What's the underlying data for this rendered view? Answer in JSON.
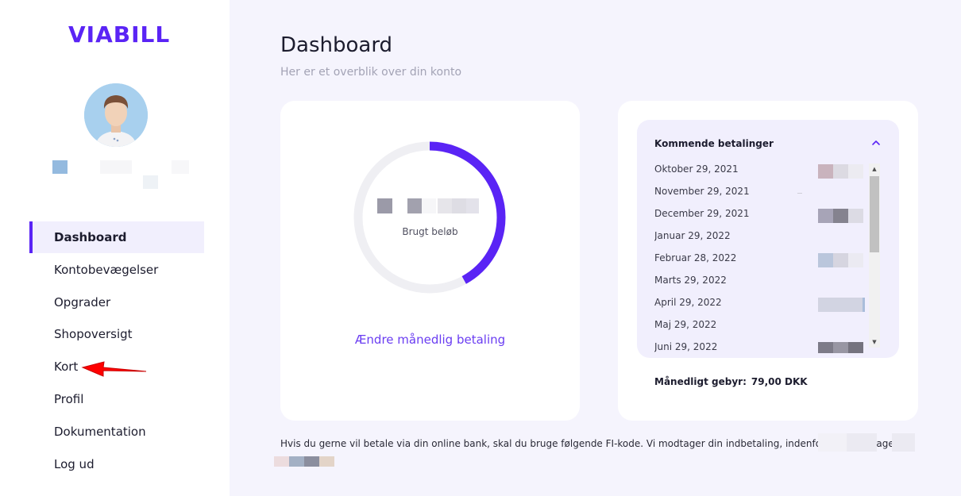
{
  "brand": {
    "logo_text": "VIABILL",
    "accent_color": "#5a24f5"
  },
  "sidebar": {
    "items": [
      {
        "label": "Dashboard",
        "active": true
      },
      {
        "label": "Kontobevægelser",
        "active": false
      },
      {
        "label": "Opgrader",
        "active": false
      },
      {
        "label": "Shopoversigt",
        "active": false
      },
      {
        "label": "Kort",
        "active": false
      },
      {
        "label": "Profil",
        "active": false
      },
      {
        "label": "Dokumentation",
        "active": false
      },
      {
        "label": "Log ud",
        "active": false
      }
    ]
  },
  "page": {
    "title": "Dashboard",
    "subtitle": "Her er et overblik over din konto"
  },
  "usage_card": {
    "used_label": "Brugt beløb",
    "used_fraction": 0.42,
    "change_link": "Ændre månedlig betaling",
    "ring_color": "#5a24f5",
    "ring_track_color": "#efeff3"
  },
  "upcoming": {
    "title": "Kommende betalinger",
    "payments": [
      {
        "date": "Oktober 29, 2021"
      },
      {
        "date": "November 29, 2021"
      },
      {
        "date": "December 29, 2021"
      },
      {
        "date": "Januar 29, 2022"
      },
      {
        "date": "Februar 28, 2022"
      },
      {
        "date": "Marts 29, 2022"
      },
      {
        "date": "April 29, 2022"
      },
      {
        "date": "Maj 29, 2022"
      },
      {
        "date": "Juni 29, 2022"
      }
    ]
  },
  "fee": {
    "label": "Månedligt gebyr:",
    "value": "79,00 DKK"
  },
  "footer": {
    "note": "Hvis du gerne vil betale via din online bank, skal du bruge følgende FI-kode. Vi modtager din indbetaling, indenfor 2-3 bankdage: +"
  },
  "icons": {
    "avatar": "user-avatar",
    "collapse": "chevron-up-icon",
    "annotation": "red-arrow-icon"
  }
}
